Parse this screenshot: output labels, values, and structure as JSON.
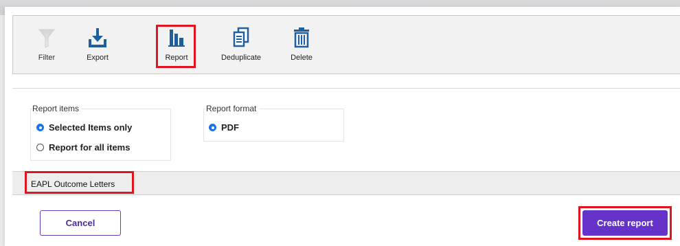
{
  "toolbar": {
    "items": [
      {
        "label": "Filter",
        "icon": "filter-icon",
        "enabled": false
      },
      {
        "label": "Export",
        "icon": "export-icon",
        "enabled": true
      },
      {
        "label": "Report",
        "icon": "report-chart-icon",
        "enabled": true,
        "highlighted": true
      },
      {
        "label": "Deduplicate",
        "icon": "deduplicate-icon",
        "enabled": true
      },
      {
        "label": "Delete",
        "icon": "trash-icon",
        "enabled": true
      }
    ]
  },
  "report_items": {
    "title": "Report items",
    "options": [
      {
        "label": "Selected Items only",
        "checked": true
      },
      {
        "label": "Report for all items",
        "checked": false
      }
    ]
  },
  "report_format": {
    "title": "Report format",
    "options": [
      {
        "label": "PDF",
        "checked": true
      }
    ]
  },
  "template": {
    "label": "EAPL Outcome Letters"
  },
  "actions": {
    "cancel_label": "Cancel",
    "create_label": "Create report"
  },
  "colors": {
    "accent": "#6533c9",
    "highlight": "#e0141e",
    "radio_checked": "#1a73e8",
    "toolbar_icon": "#1f5f9e"
  }
}
